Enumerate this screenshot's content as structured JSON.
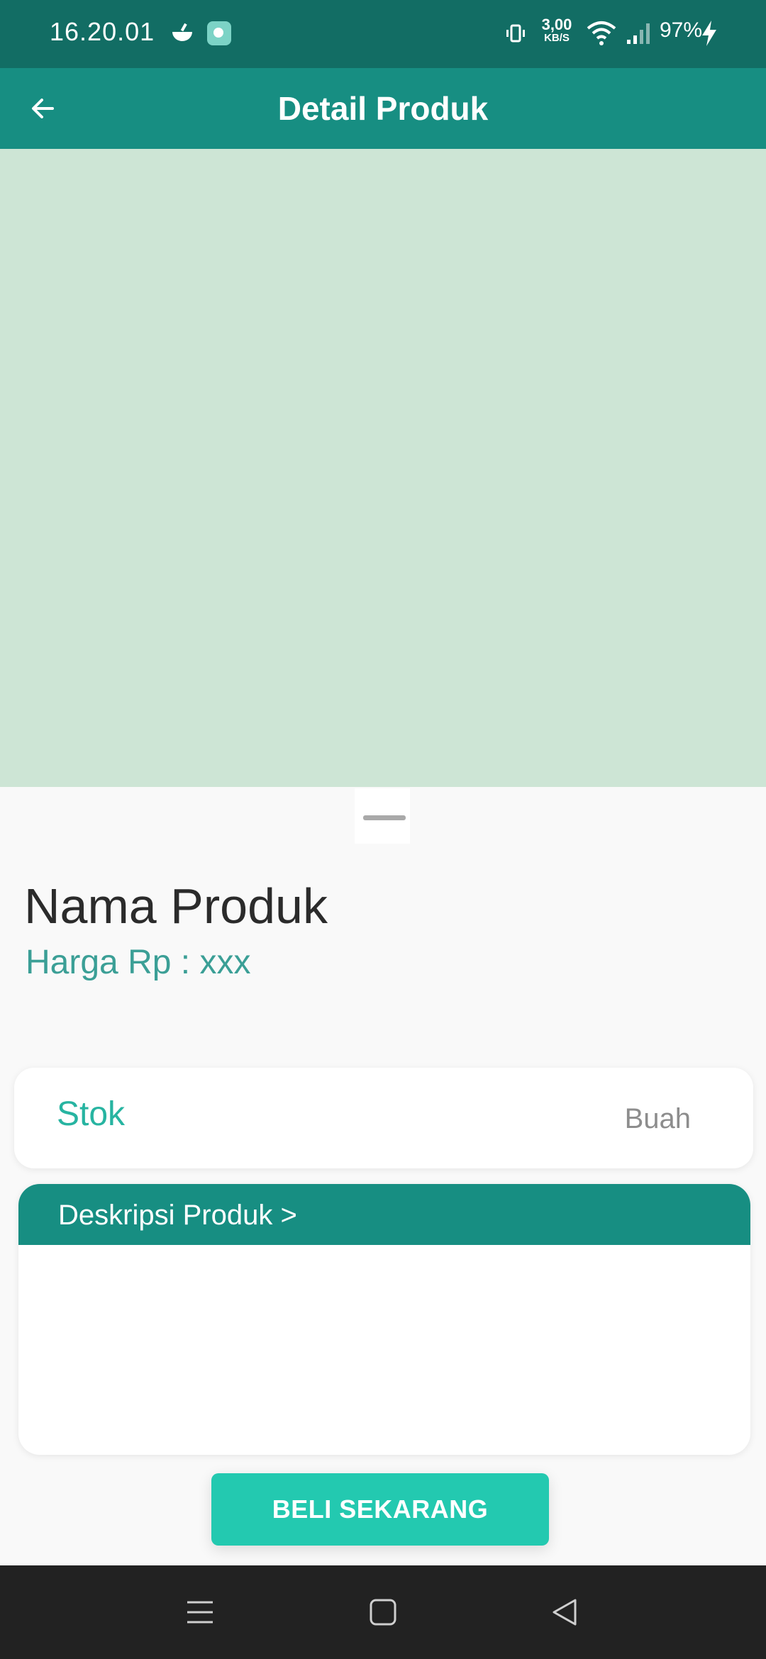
{
  "status_bar": {
    "time": "16.20.01",
    "net_speed_value": "3,00",
    "net_speed_unit": "KB/S",
    "battery": "97%",
    "icons": [
      "bowl-icon",
      "app-notification-icon",
      "vibrate-icon",
      "wifi-icon",
      "signal-icon",
      "charging-icon"
    ]
  },
  "app_bar": {
    "title": "Detail Produk",
    "back_icon": "arrow-left-icon"
  },
  "product": {
    "name": "Nama Produk",
    "price": "Harga Rp : xxx",
    "image_color": "#cde5d5"
  },
  "stock": {
    "label": "Stok",
    "unit": "Buah"
  },
  "description": {
    "title": "Deskripsi Produk >"
  },
  "actions": {
    "buy_label": "BELI SEKARANG"
  },
  "nav_bar": {
    "icons": [
      "menu-icon",
      "home-icon",
      "back-triangle-icon"
    ]
  },
  "colors": {
    "status_bar": "#126d64",
    "primary": "#178e82",
    "accent": "#23c9b0",
    "price_text": "#3b9f96"
  }
}
